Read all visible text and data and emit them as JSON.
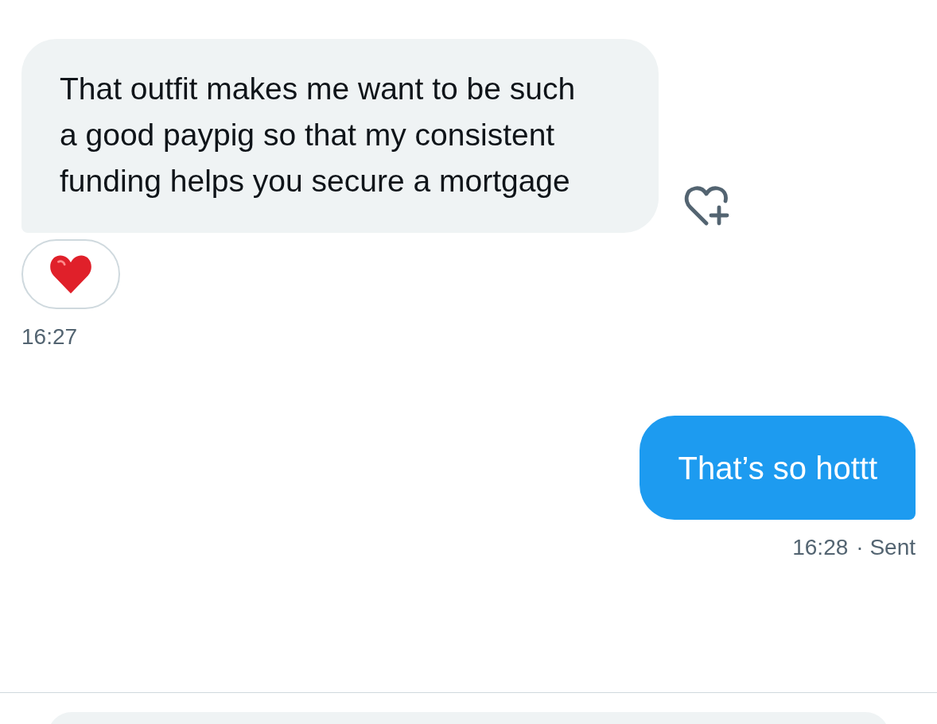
{
  "messages": [
    {
      "kind": "received",
      "text": "That outfit makes me want to be such a good paypig so that my consistent funding helps you secure a mortgage",
      "reacted": true,
      "time": "16:27"
    },
    {
      "kind": "sent",
      "text": "That’s so hottt",
      "time": "16:28",
      "status": "· Sent"
    }
  ]
}
